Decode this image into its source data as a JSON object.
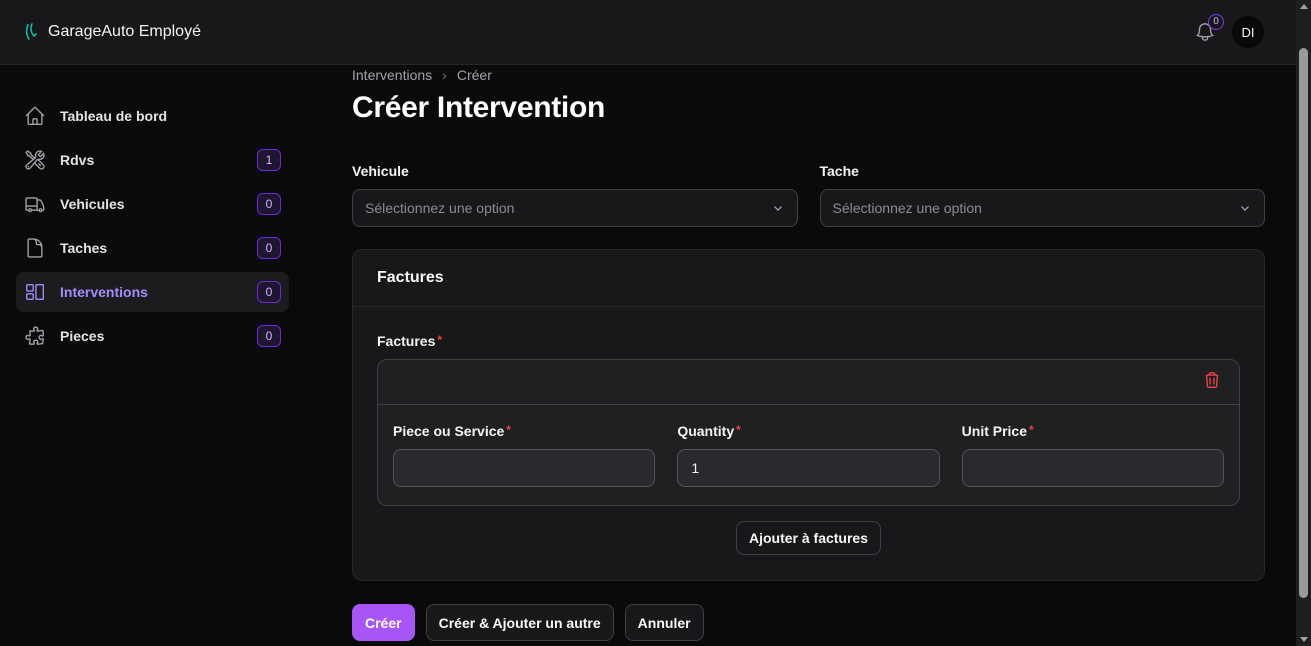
{
  "app": {
    "name": "GarageAuto Employé"
  },
  "header": {
    "notifications_count": "0",
    "avatar_initials": "DI"
  },
  "sidebar": {
    "items": [
      {
        "label": "Tableau de bord",
        "icon": "home-icon",
        "badge": null
      },
      {
        "label": "Rdvs",
        "icon": "wrench-screwdriver-icon",
        "badge": "1"
      },
      {
        "label": "Vehicules",
        "icon": "truck-icon",
        "badge": "0"
      },
      {
        "label": "Taches",
        "icon": "document-icon",
        "badge": "0"
      },
      {
        "label": "Interventions",
        "icon": "layout-icon",
        "badge": "0",
        "active": true
      },
      {
        "label": "Pieces",
        "icon": "puzzle-icon",
        "badge": "0"
      }
    ]
  },
  "breadcrumb": {
    "parent": "Interventions",
    "current": "Créer"
  },
  "page": {
    "title": "Créer Intervention"
  },
  "form": {
    "vehicule": {
      "label": "Vehicule",
      "placeholder": "Sélectionnez une option"
    },
    "tache": {
      "label": "Tache",
      "placeholder": "Sélectionnez une option"
    },
    "factures_section": {
      "title": "Factures",
      "repeater_label": "Factures",
      "required_mark": "*",
      "item": {
        "piece_label": "Piece ou Service",
        "piece_value": "",
        "quantity_label": "Quantity",
        "quantity_value": "1",
        "unit_price_label": "Unit Price",
        "unit_price_value": ""
      },
      "add_button": "Ajouter à factures"
    }
  },
  "actions": {
    "create": "Créer",
    "create_another": "Créer & Ajouter un autre",
    "cancel": "Annuler"
  },
  "colors": {
    "accent": "#a855f7",
    "background": "#0a0a0b",
    "danger": "#ef4444"
  }
}
